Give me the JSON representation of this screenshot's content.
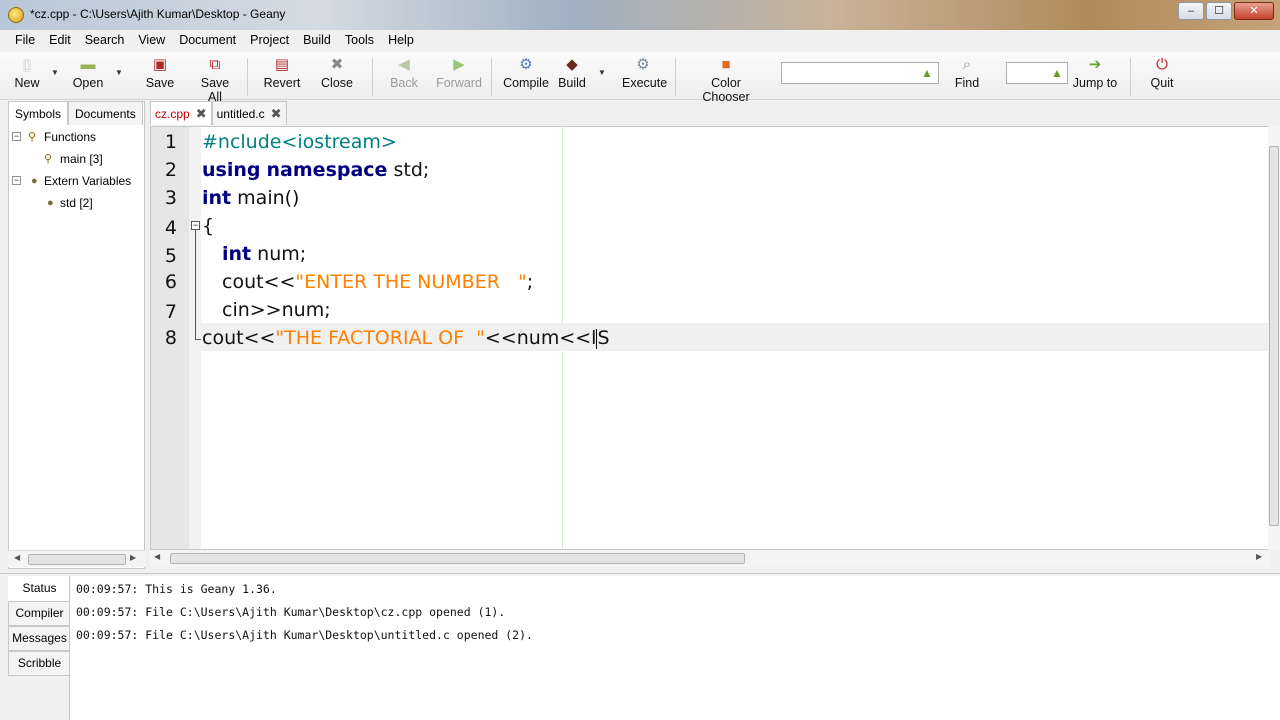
{
  "window": {
    "title": "*cz.cpp - C:\\Users\\Ajith Kumar\\Desktop - Geany",
    "controls": {
      "minimize": "–",
      "maximize": "☐",
      "close": "✕"
    }
  },
  "menu": [
    "File",
    "Edit",
    "Search",
    "View",
    "Document",
    "Project",
    "Build",
    "Tools",
    "Help"
  ],
  "toolbar": {
    "new": "New",
    "open": "Open",
    "save": "Save",
    "save_all": "Save All",
    "revert": "Revert",
    "close": "Close",
    "back": "Back",
    "forward": "Forward",
    "compile": "Compile",
    "build": "Build",
    "execute": "Execute",
    "color_chooser": "Color Chooser",
    "search_value": "",
    "find": "Find",
    "line_value": "",
    "jump_to": "Jump to",
    "quit": "Quit"
  },
  "sidebar": {
    "tabs": [
      "Symbols",
      "Documents"
    ],
    "active_tab": "Symbols",
    "tree": {
      "functions": "Functions",
      "main": "main [3]",
      "extern": "Extern Variables",
      "std": "std [2]"
    }
  },
  "editor": {
    "tabs": [
      {
        "label": "cz.cpp",
        "active": true
      },
      {
        "label": "untitled.c",
        "active": false
      }
    ],
    "line_numbers": [
      "1",
      "2",
      "3",
      "4",
      "5",
      "6",
      "7",
      "8"
    ],
    "lines": {
      "l1_pp": "#nclude<iostream>",
      "l2_kw1": "using",
      "l2_kw2": "namespace",
      "l2_rest": " std;",
      "l3_kw": "int",
      "l3_rest": " main()",
      "l4": "{",
      "l5_kw": "int",
      "l5_rest": " num;",
      "l6_pre": "cout<<",
      "l6_str": "\"ENTER THE NUMBER   \"",
      "l6_post": ";",
      "l7": "cin>>num;",
      "l8_pre": "cout<<",
      "l8_str": "\"THE FACTORIAL OF  \"",
      "l8_mid": "<<num<<",
      "l8_before_caret": "l",
      "l8_after_caret": "S"
    }
  },
  "messages": {
    "tabs": [
      "Status",
      "Compiler",
      "Messages",
      "Scribble"
    ],
    "active_tab": "Status",
    "lines": [
      "00:09:57: This is Geany 1.36.",
      "00:09:57: File C:\\Users\\Ajith Kumar\\Desktop\\cz.cpp opened (1).",
      "00:09:57: File C:\\Users\\Ajith Kumar\\Desktop\\untitled.c opened (2)."
    ]
  },
  "colors": {
    "keyword": "#000080",
    "preprocessor": "#007f7f",
    "string": "#ff8000",
    "active_tab_text": "#c00000"
  }
}
